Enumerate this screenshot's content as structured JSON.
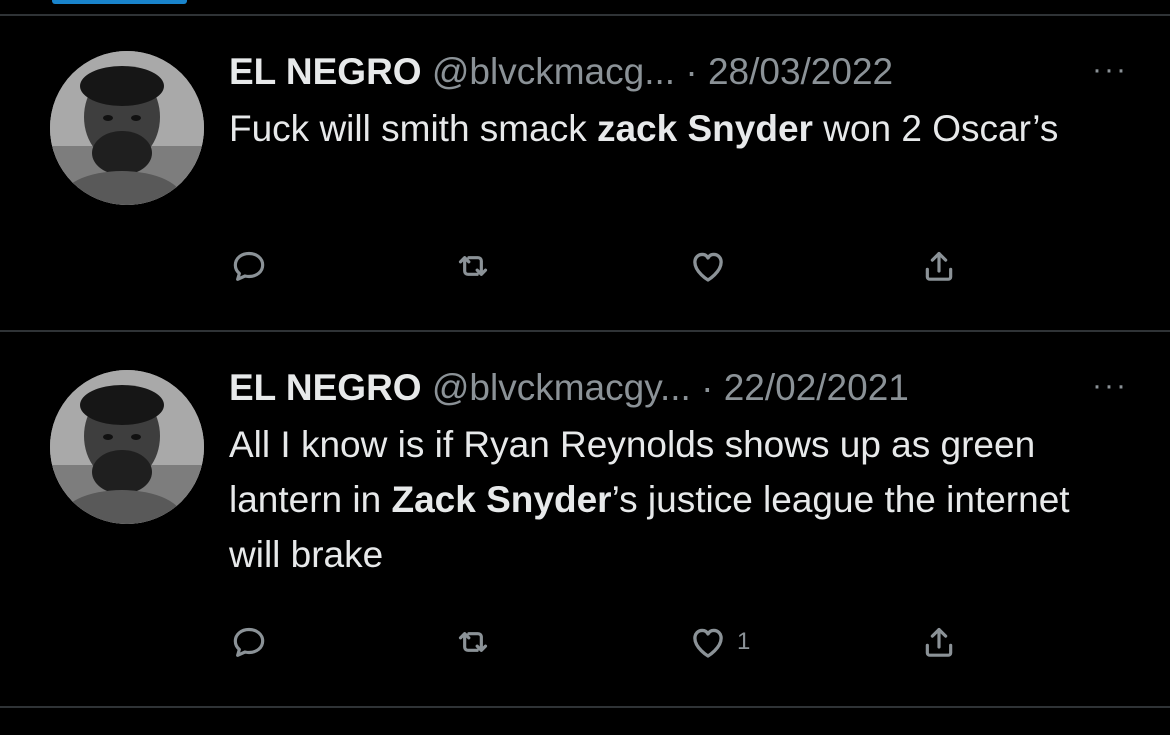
{
  "tweets": [
    {
      "name": "EL NEGRO",
      "handle": "@blvckmacg...",
      "separator": "·",
      "date": "28/03/2022",
      "more_label": "···",
      "text": {
        "p1": "Fuck will smith smack ",
        "bold1": "zack Snyder",
        "p2": " won 2 Oscar’s"
      },
      "like_count": ""
    },
    {
      "name": "EL NEGRO",
      "handle": "@blvckmacgy...",
      "separator": "·",
      "date": "22/02/2021",
      "more_label": "···",
      "text": {
        "p1": "All I know is if Ryan Reynolds shows up as green lantern in ",
        "bold1": "Zack Snyder",
        "p2": "’s justice league the internet will brake"
      },
      "like_count": "1"
    }
  ],
  "icons": {
    "reply": "reply-icon",
    "retweet": "retweet-icon",
    "like": "heart-icon",
    "share": "share-icon",
    "more": "more-icon"
  },
  "colors": {
    "background": "#000000",
    "text": "#e7e9ea",
    "muted": "#8b9297",
    "divider": "#2f3336",
    "accent": "#1d9bf0"
  }
}
